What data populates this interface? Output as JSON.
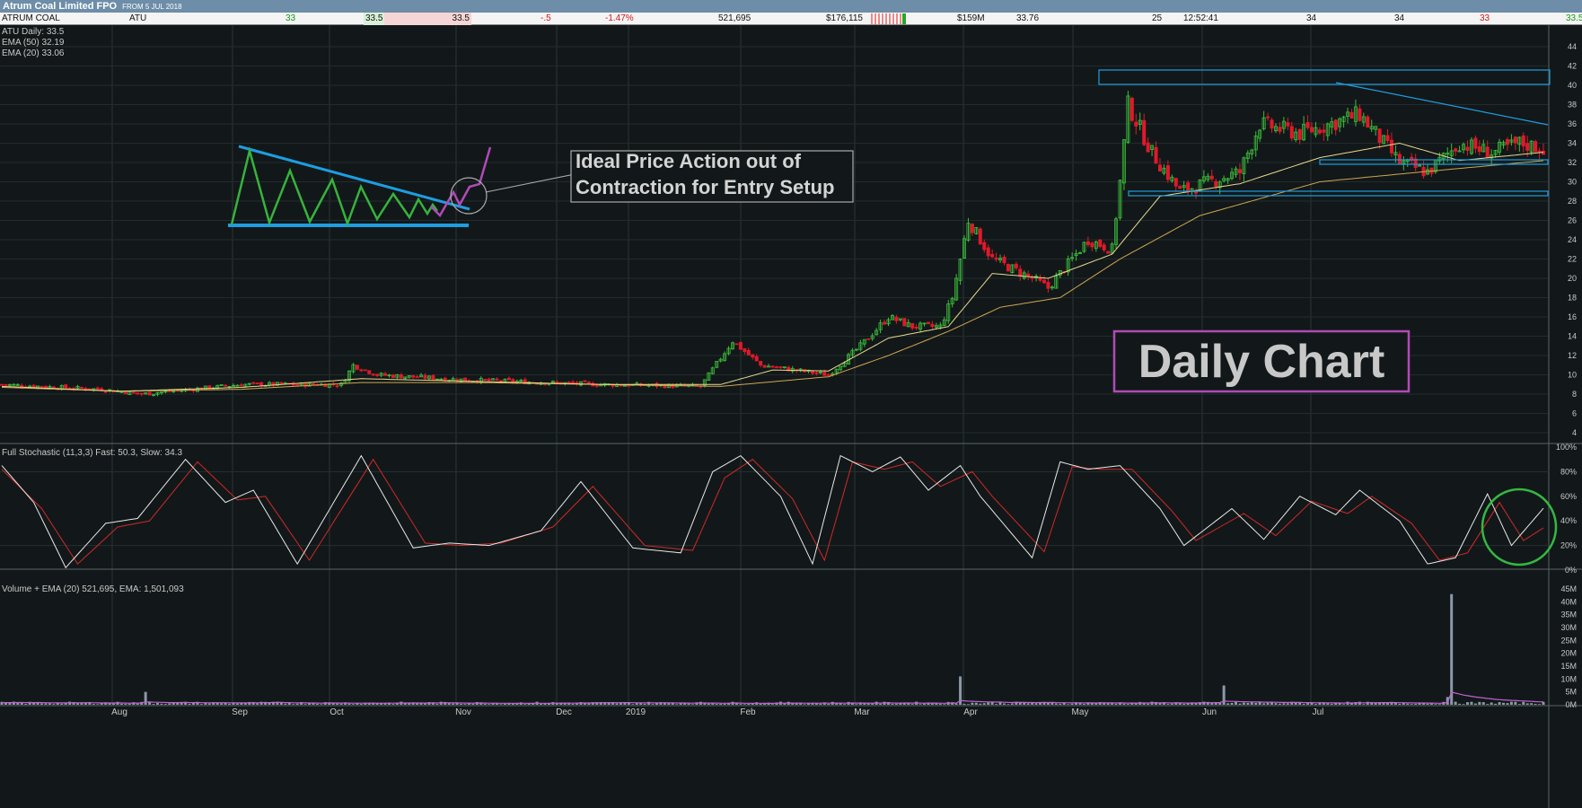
{
  "window": {
    "title": "Atrum Coal Limited FPO",
    "from_label": "FROM 5 JUL 2018"
  },
  "quote": {
    "name": "ATRUM COAL",
    "code": "ATU",
    "last": "33",
    "bid": "33.5",
    "ask": "33.5",
    "change": "-.5",
    "change_pct": "-1.47%",
    "volume": "521,695",
    "value": "$176,115",
    "market_cap": "$159M",
    "vwap": "33.76",
    "trades": "25",
    "time": "12:52:41",
    "open": "34",
    "high": "34",
    "low": "33",
    "close": "33.5"
  },
  "legends": {
    "price": [
      "ATU Daily: 33.5",
      "EMA (50) 32.19",
      "EMA (20) 33.06"
    ],
    "stochastic": "Full Stochastic (11,3,3) Fast: 50.3, Slow: 34.3",
    "volume": "Volume + EMA (20) 521,695, EMA: 1,501,093"
  },
  "annotations": {
    "callout_line1": "Ideal Price Action out of",
    "callout_line2": "Contraction for Entry Setup",
    "label": "Daily Chart"
  },
  "colors": {
    "background": "#121819",
    "up_candle": "#3cbd3c",
    "down_candle": "#e0192a",
    "ema20": "#e8d890",
    "ema50": "#cfa552",
    "stoch_fast": "#e8e8e8",
    "stoch_slow": "#d12828",
    "volume_bar": "#8a98a6",
    "volume_ema": "#c060d0",
    "trendline": "#1e9de0",
    "highlight_circle": "#34b843",
    "label_border": "#b04ab8"
  },
  "icons": [
    "price-candles",
    "trendline-pattern",
    "highlight-circle"
  ],
  "chart_data": [
    {
      "type": "candlestick",
      "x_ticks": [
        "Aug",
        "Sep",
        "Oct",
        "Nov",
        "Dec",
        "2019",
        "Feb",
        "Mar",
        "Apr",
        "May",
        "Jun",
        "Jul"
      ],
      "y_ticks": [
        "44",
        "42",
        "40",
        "38",
        "36",
        "34",
        "32",
        "30",
        "28",
        "26",
        "24",
        "22",
        "20",
        "18",
        "16",
        "14",
        "12",
        "10",
        "8",
        "6",
        "4"
      ],
      "ylim": [
        3,
        44.5
      ],
      "keypoints": [
        {
          "x": 0,
          "close": 9.0
        },
        {
          "x": 25,
          "close": 8.5
        },
        {
          "x": 35,
          "close": 8.0
        },
        {
          "x": 60,
          "close": 9.0
        },
        {
          "x": 85,
          "close": 9.0
        },
        {
          "x": 88,
          "close": 11.0
        },
        {
          "x": 94,
          "close": 10.0
        },
        {
          "x": 115,
          "close": 9.5
        },
        {
          "x": 150,
          "close": 9.0
        },
        {
          "x": 175,
          "close": 8.8
        },
        {
          "x": 183,
          "close": 13.5
        },
        {
          "x": 190,
          "close": 11.0
        },
        {
          "x": 207,
          "close": 10.0
        },
        {
          "x": 215,
          "close": 13.0
        },
        {
          "x": 222,
          "close": 16.0
        },
        {
          "x": 228,
          "close": 15.0
        },
        {
          "x": 235,
          "close": 15.0
        },
        {
          "x": 238,
          "close": 18.0
        },
        {
          "x": 242,
          "close": 26.0
        },
        {
          "x": 248,
          "close": 22.0
        },
        {
          "x": 258,
          "close": 20.0
        },
        {
          "x": 262,
          "close": 19.0
        },
        {
          "x": 272,
          "close": 24.0
        },
        {
          "x": 278,
          "close": 23.0
        },
        {
          "x": 280,
          "close": 30.0
        },
        {
          "x": 282,
          "close": 38.0
        },
        {
          "x": 288,
          "close": 33.0
        },
        {
          "x": 295,
          "close": 29.0
        },
        {
          "x": 310,
          "close": 31.0
        },
        {
          "x": 315,
          "close": 36.0
        },
        {
          "x": 325,
          "close": 35.0
        },
        {
          "x": 340,
          "close": 37.0
        },
        {
          "x": 350,
          "close": 32.0
        },
        {
          "x": 357,
          "close": 31.0
        },
        {
          "x": 365,
          "close": 34.0
        },
        {
          "x": 373,
          "close": 33.0
        },
        {
          "x": 380,
          "close": 34.0
        },
        {
          "x": 386,
          "close": 33.5
        }
      ],
      "ema20": [
        {
          "x": 0,
          "value": 8.8
        },
        {
          "x": 30,
          "value": 8.3
        },
        {
          "x": 60,
          "value": 8.7
        },
        {
          "x": 90,
          "value": 9.6
        },
        {
          "x": 120,
          "value": 9.3
        },
        {
          "x": 150,
          "value": 9.0
        },
        {
          "x": 180,
          "value": 9.0
        },
        {
          "x": 193,
          "value": 10.5
        },
        {
          "x": 207,
          "value": 10.4
        },
        {
          "x": 222,
          "value": 13.8
        },
        {
          "x": 237,
          "value": 15.0
        },
        {
          "x": 248,
          "value": 20.5
        },
        {
          "x": 262,
          "value": 20.0
        },
        {
          "x": 278,
          "value": 22.5
        },
        {
          "x": 290,
          "value": 28.5
        },
        {
          "x": 310,
          "value": 29.8
        },
        {
          "x": 330,
          "value": 32.5
        },
        {
          "x": 350,
          "value": 34.0
        },
        {
          "x": 365,
          "value": 32.2
        },
        {
          "x": 386,
          "value": 33.06
        }
      ],
      "ema50": [
        {
          "x": 0,
          "value": 8.7
        },
        {
          "x": 30,
          "value": 8.3
        },
        {
          "x": 60,
          "value": 8.5
        },
        {
          "x": 90,
          "value": 9.2
        },
        {
          "x": 120,
          "value": 9.2
        },
        {
          "x": 150,
          "value": 9.0
        },
        {
          "x": 180,
          "value": 8.8
        },
        {
          "x": 207,
          "value": 9.8
        },
        {
          "x": 222,
          "value": 12.0
        },
        {
          "x": 237,
          "value": 14.5
        },
        {
          "x": 250,
          "value": 17.0
        },
        {
          "x": 265,
          "value": 18.0
        },
        {
          "x": 280,
          "value": 22.0
        },
        {
          "x": 300,
          "value": 26.5
        },
        {
          "x": 330,
          "value": 30.0
        },
        {
          "x": 355,
          "value": 31.0
        },
        {
          "x": 386,
          "value": 32.19
        }
      ]
    },
    {
      "type": "line",
      "name": "Full Stochastic (11,3,3)",
      "y_ticks": [
        "100%",
        "80%",
        "60%",
        "40%",
        "20%",
        "0%"
      ],
      "ylim": [
        0,
        100
      ],
      "fast": [
        {
          "x": 0,
          "value": 85
        },
        {
          "x": 8,
          "value": 55
        },
        {
          "x": 16,
          "value": 2
        },
        {
          "x": 26,
          "value": 38
        },
        {
          "x": 34,
          "value": 42
        },
        {
          "x": 46,
          "value": 90
        },
        {
          "x": 56,
          "value": 55
        },
        {
          "x": 63,
          "value": 65
        },
        {
          "x": 74,
          "value": 5
        },
        {
          "x": 90,
          "value": 93
        },
        {
          "x": 103,
          "value": 18
        },
        {
          "x": 112,
          "value": 22
        },
        {
          "x": 122,
          "value": 20
        },
        {
          "x": 135,
          "value": 32
        },
        {
          "x": 145,
          "value": 72
        },
        {
          "x": 158,
          "value": 18
        },
        {
          "x": 170,
          "value": 14
        },
        {
          "x": 178,
          "value": 80
        },
        {
          "x": 185,
          "value": 93
        },
        {
          "x": 195,
          "value": 60
        },
        {
          "x": 203,
          "value": 5
        },
        {
          "x": 210,
          "value": 93
        },
        {
          "x": 218,
          "value": 80
        },
        {
          "x": 225,
          "value": 92
        },
        {
          "x": 232,
          "value": 65
        },
        {
          "x": 240,
          "value": 85
        },
        {
          "x": 245,
          "value": 60
        },
        {
          "x": 258,
          "value": 10
        },
        {
          "x": 265,
          "value": 88
        },
        {
          "x": 272,
          "value": 82
        },
        {
          "x": 280,
          "value": 85
        },
        {
          "x": 290,
          "value": 50
        },
        {
          "x": 296,
          "value": 20
        },
        {
          "x": 308,
          "value": 50
        },
        {
          "x": 316,
          "value": 25
        },
        {
          "x": 325,
          "value": 60
        },
        {
          "x": 334,
          "value": 45
        },
        {
          "x": 340,
          "value": 65
        },
        {
          "x": 350,
          "value": 40
        },
        {
          "x": 357,
          "value": 5
        },
        {
          "x": 364,
          "value": 10
        },
        {
          "x": 372,
          "value": 62
        },
        {
          "x": 378,
          "value": 20
        },
        {
          "x": 386,
          "value": 50.3
        }
      ],
      "slow": [
        {
          "x": 0,
          "value": 82
        },
        {
          "x": 10,
          "value": 50
        },
        {
          "x": 19,
          "value": 5
        },
        {
          "x": 29,
          "value": 35
        },
        {
          "x": 37,
          "value": 40
        },
        {
          "x": 49,
          "value": 88
        },
        {
          "x": 59,
          "value": 57
        },
        {
          "x": 66,
          "value": 60
        },
        {
          "x": 77,
          "value": 8
        },
        {
          "x": 93,
          "value": 90
        },
        {
          "x": 106,
          "value": 22
        },
        {
          "x": 115,
          "value": 20
        },
        {
          "x": 125,
          "value": 22
        },
        {
          "x": 138,
          "value": 35
        },
        {
          "x": 148,
          "value": 68
        },
        {
          "x": 161,
          "value": 20
        },
        {
          "x": 173,
          "value": 16
        },
        {
          "x": 181,
          "value": 75
        },
        {
          "x": 188,
          "value": 90
        },
        {
          "x": 198,
          "value": 58
        },
        {
          "x": 206,
          "value": 8
        },
        {
          "x": 213,
          "value": 88
        },
        {
          "x": 221,
          "value": 82
        },
        {
          "x": 228,
          "value": 88
        },
        {
          "x": 235,
          "value": 68
        },
        {
          "x": 243,
          "value": 80
        },
        {
          "x": 248,
          "value": 60
        },
        {
          "x": 261,
          "value": 15
        },
        {
          "x": 268,
          "value": 84
        },
        {
          "x": 275,
          "value": 82
        },
        {
          "x": 283,
          "value": 82
        },
        {
          "x": 293,
          "value": 48
        },
        {
          "x": 299,
          "value": 24
        },
        {
          "x": 311,
          "value": 46
        },
        {
          "x": 319,
          "value": 28
        },
        {
          "x": 328,
          "value": 56
        },
        {
          "x": 337,
          "value": 46
        },
        {
          "x": 343,
          "value": 60
        },
        {
          "x": 353,
          "value": 38
        },
        {
          "x": 360,
          "value": 8
        },
        {
          "x": 367,
          "value": 14
        },
        {
          "x": 375,
          "value": 55
        },
        {
          "x": 381,
          "value": 24
        },
        {
          "x": 386,
          "value": 34.3
        }
      ]
    },
    {
      "type": "bar",
      "name": "Volume",
      "y_ticks": [
        "45M",
        "40M",
        "35M",
        "30M",
        "25M",
        "20M",
        "15M",
        "10M",
        "5M",
        "0M"
      ],
      "ylim": [
        0,
        47
      ],
      "spikes": [
        {
          "x": 36,
          "value": 5
        },
        {
          "x": 240,
          "value": 11
        },
        {
          "x": 306,
          "value": 7.5
        },
        {
          "x": 363,
          "value": 43
        },
        {
          "x": 362,
          "value": 3
        }
      ],
      "base_level": 0.8
    }
  ]
}
